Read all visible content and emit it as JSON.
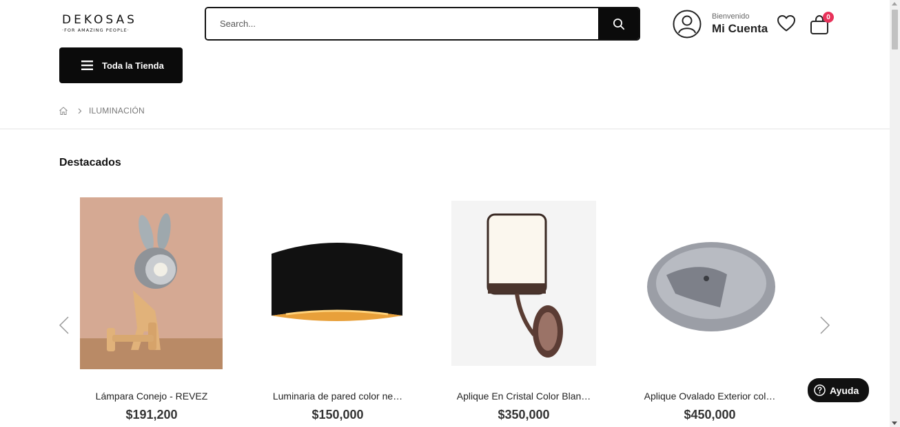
{
  "header": {
    "logo_main": "DEKOSAS",
    "logo_sub": "·FOR AMAZING PEOPLE·",
    "search_placeholder": "Search...",
    "account_welcome": "Bienvenido",
    "account_name": "Mi Cuenta",
    "cart_count": "0"
  },
  "nav": {
    "store_label": "Toda la Tienda"
  },
  "breadcrumb": {
    "current": "ILUMINACIÓN"
  },
  "section": {
    "title": "Destacados"
  },
  "products": [
    {
      "name": "Lámpara Conejo - REVEZ",
      "price": "$191,200"
    },
    {
      "name": "Luminaria de pared color ne…",
      "price": "$150,000"
    },
    {
      "name": "Aplique En Cristal Color Blan…",
      "price": "$350,000"
    },
    {
      "name": "Aplique Ovalado Exterior col…",
      "price": "$450,000"
    }
  ],
  "help": {
    "label": "Ayuda"
  },
  "colors": {
    "primary_dark": "#0b0b0b",
    "badge": "#e8325a",
    "text": "#222222"
  }
}
